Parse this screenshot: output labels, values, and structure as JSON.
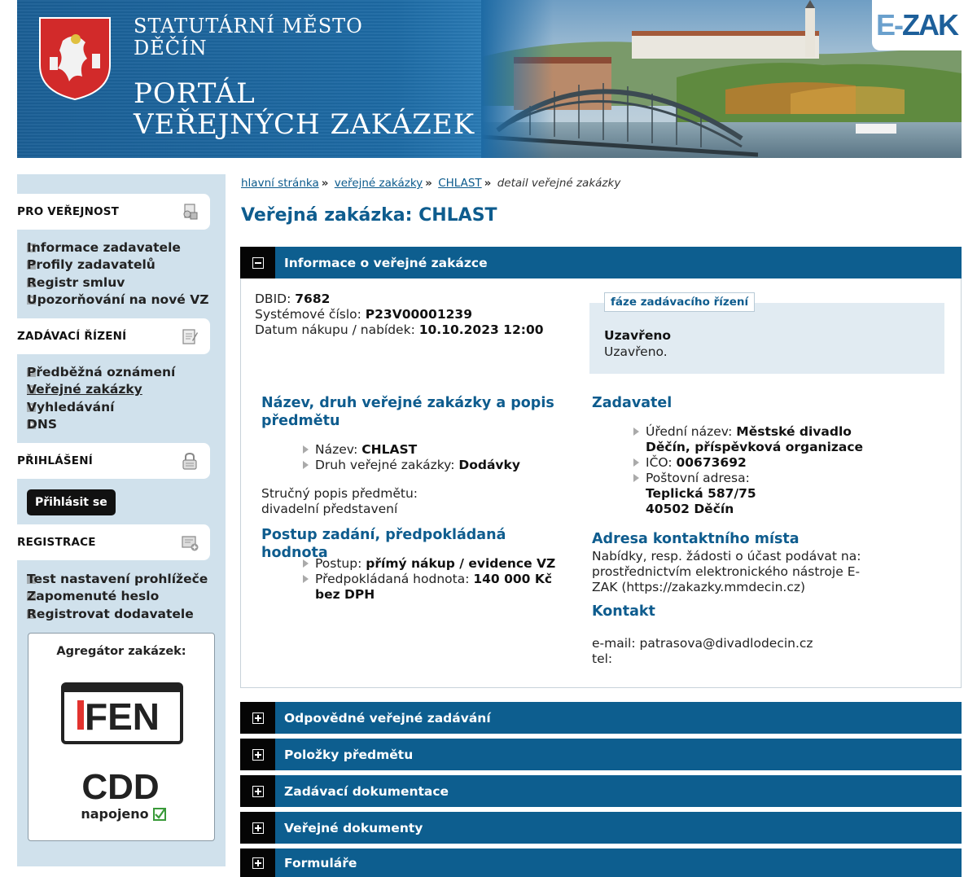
{
  "header": {
    "city_line1": "STATUTÁRNÍ MĚSTO",
    "city_line2": "DĚČÍN",
    "portal_line1": "PORTÁL",
    "portal_line2": "VEŘEJNÝCH ZAKÁZEK",
    "logo_e": "E-",
    "logo_zak": "ZAK"
  },
  "sidebar": {
    "sections": [
      {
        "title": "PRO VEŘEJNOST",
        "icon": "public-info-icon",
        "items": [
          "Informace zadavatele",
          "Profily zadavatelů",
          "Registr smluv",
          "Upozorňování na nové VZ"
        ]
      },
      {
        "title": "ZADÁVACÍ ŘÍZENÍ",
        "icon": "procurement-icon",
        "items": [
          "Předběžná oznámení",
          "Veřejné zakázky",
          "Vyhledávání",
          "DNS"
        ]
      },
      {
        "title": "PŘIHLÁŠENÍ",
        "icon": "lock-icon",
        "button": "Přihlásit se"
      },
      {
        "title": "REGISTRACE",
        "icon": "register-icon",
        "items": [
          "Test nastavení prohlížeče",
          "Zapomenuté heslo",
          "Registrovat dodavatele"
        ]
      }
    ],
    "aggregator": {
      "title": "Agregátor zakázek:",
      "fen": "FEN",
      "cdd": "CDD",
      "cdd_sub": "napojeno"
    }
  },
  "breadcrumb": {
    "home": "hlavní stránka",
    "tenders": "veřejné zakázky",
    "tender": "CHLAST",
    "current": "detail veřejné zakázky"
  },
  "page_title": "Veřejná zakázka: CHLAST",
  "info": {
    "section_title": "Informace o veřejné zakázce",
    "dbid_label": "DBID:",
    "dbid": "7682",
    "sysnum_label": "Systémové číslo:",
    "sysnum": "P23V00001239",
    "date_label": "Datum nákupu / nabídek:",
    "date": "10.10.2023 12:00",
    "phase_tab": "fáze zadávacího řízení",
    "phase_status": "Uzavřeno",
    "phase_note": "Uzavřeno.",
    "name_heading": "Název, druh veřejné zakázky a popis předmětu",
    "name_label": "Název:",
    "name": "CHLAST",
    "type_label": "Druh veřejné zakázky:",
    "type": "Dodávky",
    "desc_label": "Stručný popis předmětu:",
    "desc": "divadelní představení",
    "procedure_heading": "Postup zadání, předpokládaná hodnota",
    "procedure_label": "Postup:",
    "procedure": "přímý nákup / evidence VZ",
    "value_label": "Předpokládaná hodnota:",
    "value": "140 000 Kč bez DPH",
    "contracting_heading": "Zadavatel",
    "official_name_label": "Úřední název:",
    "official_name": "Městské divadlo Děčín, příspěvková organizace",
    "ico_label": "IČO:",
    "ico": "00673692",
    "address_label": "Poštovní adresa:",
    "address_line1": "Teplická 587/75",
    "address_line2": "40502 Děčín",
    "contact_place_heading": "Adresa kontaktního místa",
    "contact_place_text": "Nabídky, resp. žádosti o účast podávat na: prostřednictvím elektronického nástroje E-ZAK (https://zakazky.mmdecin.cz)",
    "contact_heading": "Kontakt",
    "email_line": "e-mail: patrasova@divadlodecin.cz",
    "tel_line": "tel:"
  },
  "collapsed_sections": [
    "Odpovědné veřejné zadávání",
    "Položky předmětu",
    "Zadávací dokumentace",
    "Veřejné dokumenty",
    "Formuláře"
  ]
}
